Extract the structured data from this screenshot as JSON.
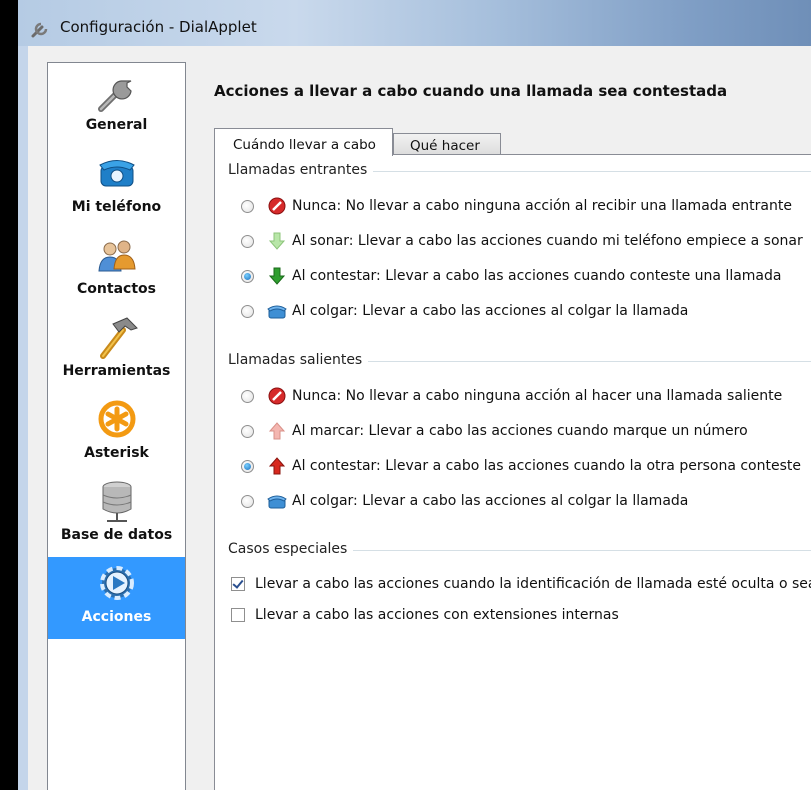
{
  "window": {
    "title": "Configuración - DialApplet"
  },
  "sidebar": {
    "items": [
      {
        "label": "General",
        "icon": "wrench-icon"
      },
      {
        "label": "Mi teléfono",
        "icon": "phone-icon"
      },
      {
        "label": "Contactos",
        "icon": "contacts-icon"
      },
      {
        "label": "Herramientas",
        "icon": "hammer-icon"
      },
      {
        "label": "Asterisk",
        "icon": "asterisk-icon"
      },
      {
        "label": "Base de datos",
        "icon": "database-icon"
      },
      {
        "label": "Acciones",
        "icon": "gear-icon",
        "selected": true
      }
    ]
  },
  "main": {
    "heading": "Acciones a llevar a cabo cuando una llamada sea contestada",
    "tabs": [
      {
        "label": "Cuándo llevar a cabo",
        "active": true
      },
      {
        "label": "Qué hacer",
        "active": false
      }
    ],
    "incoming": {
      "title": "Llamadas entrantes",
      "options": [
        {
          "text": "Nunca: No llevar a cabo ninguna acción al recibir una llamada entrante",
          "icon": "no-entry-icon",
          "selected": false
        },
        {
          "text": "Al sonar: Llevar a cabo las acciones cuando mi teléfono empiece a sonar",
          "icon": "light-green-arrow-down-icon",
          "selected": false
        },
        {
          "text": "Al contestar: Llevar a cabo las acciones cuando conteste una llamada",
          "icon": "green-arrow-down-icon",
          "selected": true
        },
        {
          "text": "Al colgar: Llevar a cabo las acciones al colgar la llamada",
          "icon": "phone-hangup-icon",
          "selected": false
        }
      ]
    },
    "outgoing": {
      "title": "Llamadas salientes",
      "options": [
        {
          "text": "Nunca: No llevar a cabo ninguna acción al hacer una llamada saliente",
          "icon": "no-entry-icon",
          "selected": false
        },
        {
          "text": "Al marcar: Llevar a cabo las acciones cuando marque un número",
          "icon": "light-red-arrow-up-icon",
          "selected": false
        },
        {
          "text": "Al contestar: Llevar a cabo las acciones cuando la otra persona conteste",
          "icon": "red-arrow-up-icon",
          "selected": true
        },
        {
          "text": "Al colgar: Llevar a cabo las acciones al colgar la llamada",
          "icon": "phone-hangup-icon",
          "selected": false
        }
      ]
    },
    "special": {
      "title": "Casos especiales",
      "options": [
        {
          "text": "Llevar a cabo las acciones cuando la identificación de llamada esté oculta o sea d",
          "checked": true
        },
        {
          "text": "Llevar a cabo las acciones con extensiones internas",
          "checked": false
        }
      ]
    }
  }
}
